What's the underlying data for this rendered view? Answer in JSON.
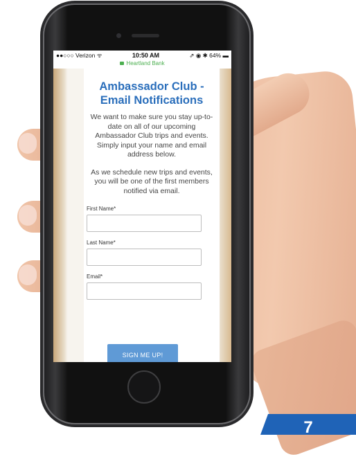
{
  "status_bar": {
    "carrier": "●●○○○ Verizon ᯤ",
    "time": "10:50 AM",
    "right": "⇗ ◉ ✱ 64% ▬"
  },
  "browser": {
    "url": "Heartland Bank"
  },
  "page": {
    "title_line1": "Ambassador Club -",
    "title_line2": "Email Notifications",
    "paragraph1": "We want to make sure you stay up-to-date on all of our upcoming Ambassador Club trips and events. Simply input your name and email address below.",
    "paragraph2": "As we schedule new  trips and events, you will be one of the first members notified via email."
  },
  "form": {
    "first_name_label": "First Name*",
    "last_name_label": "Last Name*",
    "email_label": "Email*",
    "submit_label": "SIGN ME UP!"
  },
  "footer": {
    "page_number": "7"
  },
  "colors": {
    "title": "#2a6ebb",
    "button": "#5f9ad6",
    "badge": "#1f63b7"
  }
}
